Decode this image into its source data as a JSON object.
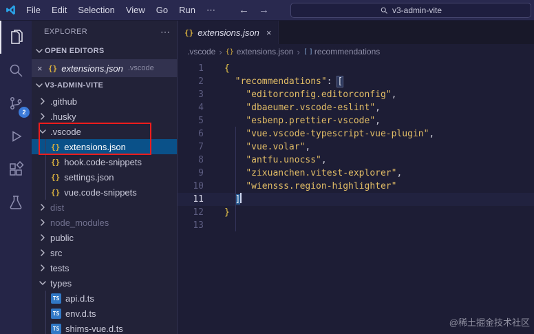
{
  "titlebar": {
    "menus": [
      "File",
      "Edit",
      "Selection",
      "View",
      "Go",
      "Run"
    ],
    "more_label": "⋯",
    "back": "←",
    "forward": "→",
    "search_value": "v3-admin-vite"
  },
  "activitybar": {
    "scm_badge": "2"
  },
  "sidebar": {
    "title": "EXPLORER",
    "actions": "⋯",
    "open_editors_label": "OPEN EDITORS",
    "open_editor": {
      "close": "×",
      "icon": "{}",
      "name": "extensions.json",
      "detail": ".vscode"
    },
    "project_label": "V3-ADMIN-VITE",
    "tree": [
      {
        "label": ".github",
        "type": "folder",
        "expanded": false
      },
      {
        "label": ".husky",
        "type": "folder",
        "expanded": false
      },
      {
        "label": ".vscode",
        "type": "folder",
        "expanded": true
      },
      {
        "label": "extensions.json",
        "type": "file",
        "icon": "json",
        "selected": true
      },
      {
        "label": "hook.code-snippets",
        "type": "file",
        "icon": "json"
      },
      {
        "label": "settings.json",
        "type": "file",
        "icon": "json"
      },
      {
        "label": "vue.code-snippets",
        "type": "file",
        "icon": "json"
      },
      {
        "label": "dist",
        "type": "folder",
        "expanded": false,
        "dim": true
      },
      {
        "label": "node_modules",
        "type": "folder",
        "expanded": false,
        "dim": true
      },
      {
        "label": "public",
        "type": "folder",
        "expanded": false
      },
      {
        "label": "src",
        "type": "folder",
        "expanded": false
      },
      {
        "label": "tests",
        "type": "folder",
        "expanded": false
      },
      {
        "label": "types",
        "type": "folder",
        "expanded": true
      },
      {
        "label": "api.d.ts",
        "type": "file",
        "icon": "ts"
      },
      {
        "label": "env.d.ts",
        "type": "file",
        "icon": "ts"
      },
      {
        "label": "shims-vue.d.ts",
        "type": "file",
        "icon": "ts"
      }
    ]
  },
  "editor": {
    "tab": {
      "icon": "{}",
      "label": "extensions.json",
      "close": "×"
    },
    "breadcrumbs": [
      {
        "label": ".vscode"
      },
      {
        "label": "extensions.json",
        "icon": "{}"
      },
      {
        "label": "recommendations",
        "icon": "[ ]"
      }
    ],
    "active_line": 11,
    "lines": [
      {
        "n": 1,
        "tokens": [
          [
            "{",
            "g"
          ]
        ]
      },
      {
        "n": 2,
        "tokens": [
          [
            "  ",
            "p"
          ],
          [
            "\"recommendations\"",
            "k"
          ],
          [
            ": ",
            "p"
          ],
          [
            "[",
            "b"
          ]
        ]
      },
      {
        "n": 3,
        "tokens": [
          [
            "    ",
            "p"
          ],
          [
            "\"editorconfig.editorconfig\"",
            "s"
          ],
          [
            ",",
            "p"
          ]
        ]
      },
      {
        "n": 4,
        "tokens": [
          [
            "    ",
            "p"
          ],
          [
            "\"dbaeumer.vscode-eslint\"",
            "s"
          ],
          [
            ",",
            "p"
          ]
        ]
      },
      {
        "n": 5,
        "tokens": [
          [
            "    ",
            "p"
          ],
          [
            "\"esbenp.prettier-vscode\"",
            "s"
          ],
          [
            ",",
            "p"
          ]
        ]
      },
      {
        "n": 6,
        "tokens": [
          [
            "    ",
            "p"
          ],
          [
            "\"vue.vscode-typescript-vue-plugin\"",
            "s"
          ],
          [
            ",",
            "p"
          ]
        ]
      },
      {
        "n": 7,
        "tokens": [
          [
            "    ",
            "p"
          ],
          [
            "\"vue.volar\"",
            "s"
          ],
          [
            ",",
            "p"
          ]
        ]
      },
      {
        "n": 8,
        "tokens": [
          [
            "    ",
            "p"
          ],
          [
            "\"antfu.unocss\"",
            "s"
          ],
          [
            ",",
            "p"
          ]
        ]
      },
      {
        "n": 9,
        "tokens": [
          [
            "    ",
            "p"
          ],
          [
            "\"zixuanchen.vitest-explorer\"",
            "s"
          ],
          [
            ",",
            "p"
          ]
        ]
      },
      {
        "n": 10,
        "tokens": [
          [
            "    ",
            "p"
          ],
          [
            "\"wiensss.region-highlighter\"",
            "s"
          ]
        ]
      },
      {
        "n": 11,
        "tokens": [
          [
            "  ",
            "p"
          ],
          [
            "]",
            "bc"
          ]
        ]
      },
      {
        "n": 12,
        "tokens": [
          [
            "}",
            "g"
          ]
        ]
      },
      {
        "n": 13,
        "tokens": []
      }
    ]
  },
  "watermark": "@稀土掘金技术社区",
  "colors": {
    "selection_blue": "#0a5189",
    "badge_blue": "#3b7ad9",
    "annotation_red": "#ee1c1c",
    "string_gold": "#e2bd66",
    "ts_icon_blue": "#3178c6",
    "json_icon_gold": "#d9b13f"
  }
}
